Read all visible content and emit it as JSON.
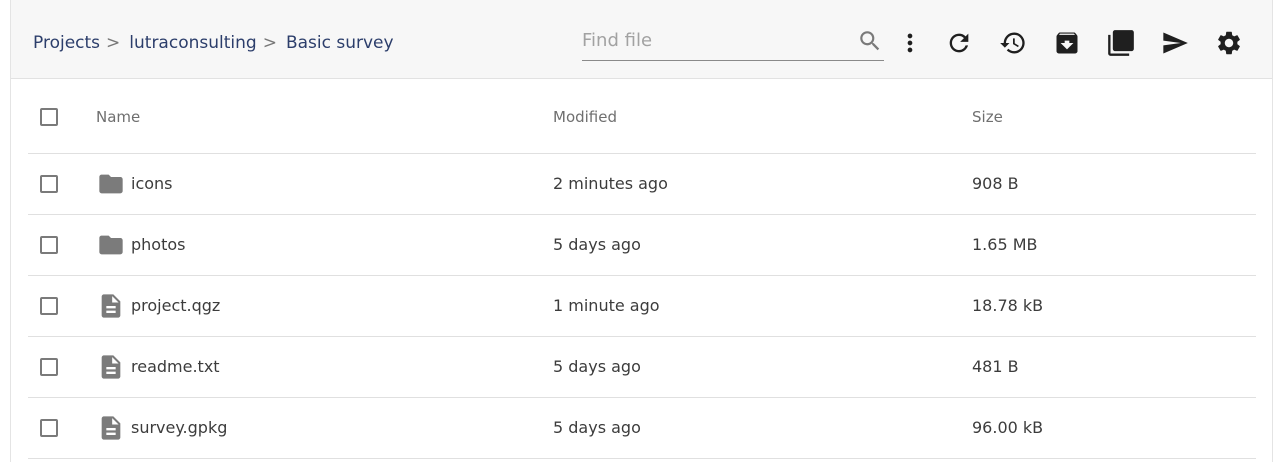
{
  "breadcrumb": [
    {
      "label": "Projects"
    },
    {
      "label": "lutraconsulting"
    },
    {
      "label": "Basic survey"
    }
  ],
  "breadcrumb_separator": ">",
  "search": {
    "placeholder": "Find file",
    "value": ""
  },
  "toolbar_icons": [
    "more-vertical-icon",
    "refresh-icon",
    "history-icon",
    "archive-icon",
    "copy-icon",
    "send-icon",
    "settings-icon"
  ],
  "table": {
    "columns": [
      "Name",
      "Modified",
      "Size"
    ],
    "rows": [
      {
        "type": "folder",
        "name": "icons",
        "modified": "2 minutes ago",
        "size": "908 B"
      },
      {
        "type": "folder",
        "name": "photos",
        "modified": "5 days ago",
        "size": "1.65 MB"
      },
      {
        "type": "file",
        "name": "project.qgz",
        "modified": "1 minute ago",
        "size": "18.78 kB"
      },
      {
        "type": "file",
        "name": "readme.txt",
        "modified": "5 days ago",
        "size": "481 B"
      },
      {
        "type": "file",
        "name": "survey.gpkg",
        "modified": "5 days ago",
        "size": "96.00 kB"
      }
    ]
  }
}
